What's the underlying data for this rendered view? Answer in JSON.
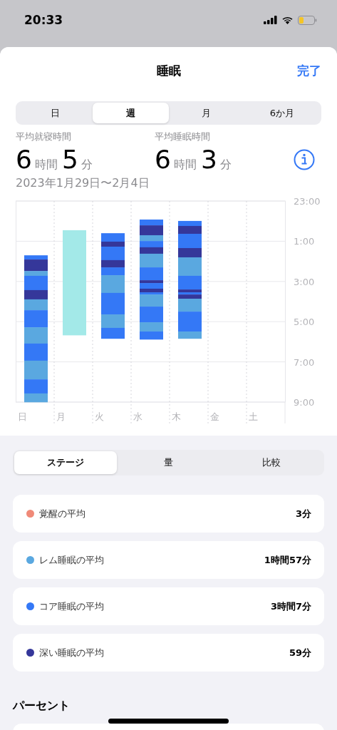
{
  "status_bar": {
    "time": "20:33"
  },
  "header": {
    "title": "睡眠",
    "done": "完了"
  },
  "range_tabs": [
    {
      "label": "日",
      "selected": false
    },
    {
      "label": "週",
      "selected": true
    },
    {
      "label": "月",
      "selected": false
    },
    {
      "label": "6か月",
      "selected": false
    }
  ],
  "stats": [
    {
      "label": "平均就寝時間",
      "parts": [
        {
          "kind": "number",
          "text": "6"
        },
        {
          "kind": "unit",
          "text": "時間"
        },
        {
          "kind": "number",
          "text": "5"
        },
        {
          "kind": "unit",
          "text": "分"
        }
      ]
    },
    {
      "label": "平均睡眠時間",
      "parts": [
        {
          "kind": "number",
          "text": "6"
        },
        {
          "kind": "unit",
          "text": "時間"
        },
        {
          "kind": "number",
          "text": "3"
        },
        {
          "kind": "unit",
          "text": "分"
        }
      ]
    }
  ],
  "date_range": "2023年1月29日〜2月4日",
  "sleep_chart": {
    "time_labels": [
      "23:00",
      "1:00",
      "3:00",
      "5:00",
      "7:00",
      "9:00"
    ],
    "days": [
      {
        "label": "日"
      },
      {
        "label": "月"
      },
      {
        "label": "火"
      },
      {
        "label": "水"
      },
      {
        "label": "木"
      },
      {
        "label": "金"
      },
      {
        "label": "土"
      }
    ]
  },
  "view_tabs": [
    {
      "label": "ステージ",
      "selected": true
    },
    {
      "label": "量",
      "selected": false
    },
    {
      "label": "比較",
      "selected": false
    }
  ],
  "averages": [
    {
      "label": "覚醒の平均",
      "value": "3分",
      "color": "#f08a78"
    },
    {
      "label": "レム睡眠の平均",
      "value": "1時間57分",
      "color": "#5aa8e0"
    },
    {
      "label": "コア睡眠の平均",
      "value": "3時間7分",
      "color": "#3478f6"
    },
    {
      "label": "深い睡眠の平均",
      "value": "59分",
      "color": "#35379a"
    }
  ],
  "percent_title": "パーセント"
}
